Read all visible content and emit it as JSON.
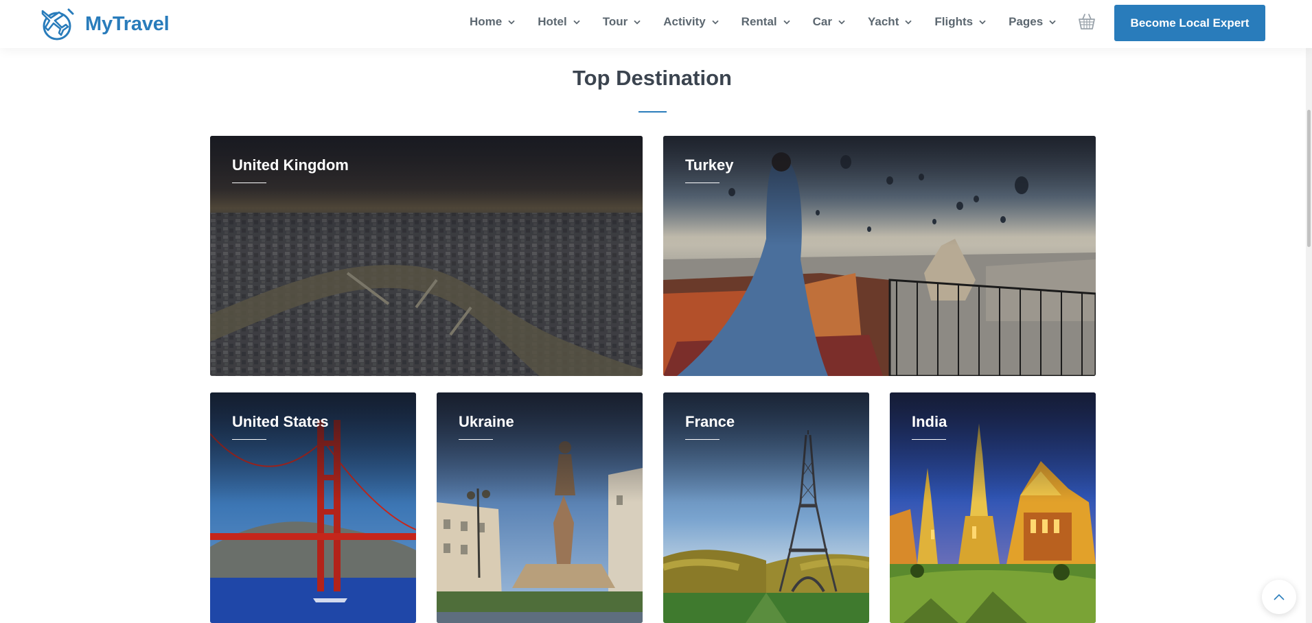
{
  "brand": {
    "name": "MyTravel",
    "accent": "#297cbb"
  },
  "nav": {
    "items": [
      {
        "label": "Home"
      },
      {
        "label": "Hotel"
      },
      {
        "label": "Tour"
      },
      {
        "label": "Activity"
      },
      {
        "label": "Rental"
      },
      {
        "label": "Car"
      },
      {
        "label": "Yacht"
      },
      {
        "label": "Flights"
      },
      {
        "label": "Pages"
      }
    ],
    "cart_icon": "basket-icon",
    "cta_label": "Become Local Expert"
  },
  "section": {
    "title": "Top Destination"
  },
  "destinations": [
    {
      "name": "United Kingdom"
    },
    {
      "name": "Turkey"
    },
    {
      "name": "United States"
    },
    {
      "name": "Ukraine"
    },
    {
      "name": "France"
    },
    {
      "name": "India"
    }
  ],
  "scroll_top_icon": "chevron-up-icon"
}
